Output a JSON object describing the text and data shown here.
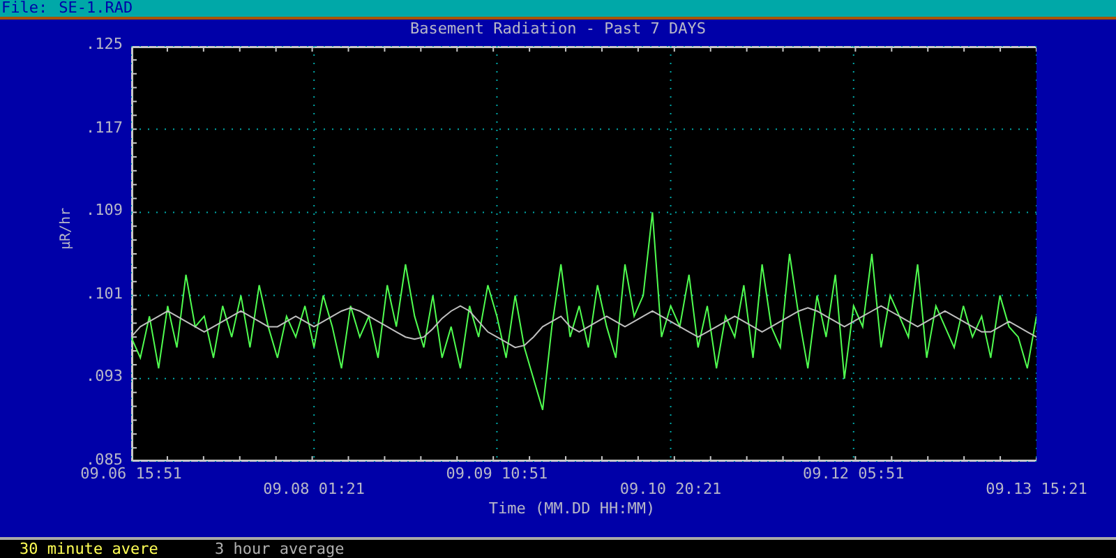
{
  "file_bar": {
    "label": "File:",
    "filename": "SE-1.RAD"
  },
  "chart_data": {
    "type": "line",
    "title": "Basement Radiation - Past 7 DAYS",
    "xlabel": "Time (MM.DD HH:MM)",
    "ylabel": "µR/hr",
    "categories": [
      "09.06 15:51",
      null,
      null,
      null,
      null,
      null,
      null,
      null,
      null,
      null,
      null,
      null,
      null,
      null,
      null,
      null,
      null,
      null,
      null,
      null,
      "09.08 01:21",
      null,
      null,
      null,
      null,
      null,
      null,
      null,
      null,
      null,
      null,
      null,
      null,
      null,
      null,
      null,
      null,
      null,
      null,
      null,
      "09.09 10:51",
      null,
      null,
      null,
      null,
      null,
      null,
      null,
      null,
      null,
      null,
      null,
      null,
      null,
      null,
      null,
      null,
      null,
      null,
      "09.10 20:21",
      null,
      null,
      null,
      null,
      null,
      null,
      null,
      null,
      null,
      null,
      null,
      null,
      null,
      null,
      null,
      null,
      null,
      null,
      null,
      "09.12 05:51",
      null,
      null,
      null,
      null,
      null,
      null,
      null,
      null,
      null,
      null,
      null,
      null,
      null,
      null,
      null,
      null,
      null,
      null,
      null,
      "09.13 15:21"
    ],
    "ylim": [
      0.085,
      0.125
    ],
    "grid": true,
    "yticks": [
      {
        "value": 0.125,
        "label": ".125"
      },
      {
        "value": 0.117,
        "label": ".117"
      },
      {
        "value": 0.109,
        "label": ".109"
      },
      {
        "value": 0.101,
        "label": ".101"
      },
      {
        "value": 0.093,
        "label": ".093"
      },
      {
        "value": 0.085,
        "label": ".085"
      }
    ],
    "series": [
      {
        "name": "30 minute avere",
        "color": "#50ff50",
        "values": [
          0.097,
          0.095,
          0.099,
          0.094,
          0.1,
          0.096,
          0.103,
          0.098,
          0.099,
          0.095,
          0.1,
          0.097,
          0.101,
          0.096,
          0.102,
          0.098,
          0.095,
          0.099,
          0.097,
          0.1,
          0.096,
          0.101,
          0.098,
          0.094,
          0.1,
          0.097,
          0.099,
          0.095,
          0.102,
          0.098,
          0.104,
          0.099,
          0.096,
          0.101,
          0.095,
          0.098,
          0.094,
          0.1,
          0.097,
          0.102,
          0.099,
          0.095,
          0.101,
          0.096,
          0.093,
          0.09,
          0.098,
          0.104,
          0.097,
          0.1,
          0.096,
          0.102,
          0.098,
          0.095,
          0.104,
          0.099,
          0.101,
          0.109,
          0.097,
          0.1,
          0.098,
          0.103,
          0.096,
          0.1,
          0.094,
          0.099,
          0.097,
          0.102,
          0.095,
          0.104,
          0.098,
          0.096,
          0.105,
          0.099,
          0.094,
          0.101,
          0.097,
          0.103,
          0.093,
          0.1,
          0.098,
          0.105,
          0.096,
          0.101,
          0.099,
          0.097,
          0.104,
          0.095,
          0.1,
          0.098,
          0.096,
          0.1,
          0.097,
          0.099,
          0.095,
          0.101,
          0.098,
          0.097,
          0.094,
          0.099
        ]
      },
      {
        "name": "3 hour average",
        "color": "#c0c0c0",
        "values": [
          0.097,
          0.098,
          0.0985,
          0.099,
          0.0995,
          0.099,
          0.0985,
          0.098,
          0.0975,
          0.098,
          0.0985,
          0.099,
          0.0995,
          0.099,
          0.0985,
          0.098,
          0.098,
          0.0985,
          0.099,
          0.0985,
          0.098,
          0.0985,
          0.099,
          0.0995,
          0.0998,
          0.0995,
          0.099,
          0.0985,
          0.098,
          0.0975,
          0.097,
          0.0968,
          0.097,
          0.0978,
          0.0988,
          0.0995,
          0.1,
          0.0995,
          0.0985,
          0.0975,
          0.097,
          0.0965,
          0.096,
          0.0962,
          0.097,
          0.098,
          0.0985,
          0.099,
          0.098,
          0.0975,
          0.098,
          0.0985,
          0.099,
          0.0985,
          0.098,
          0.0985,
          0.099,
          0.0995,
          0.099,
          0.0985,
          0.098,
          0.0975,
          0.097,
          0.0975,
          0.098,
          0.0985,
          0.099,
          0.0985,
          0.098,
          0.0975,
          0.098,
          0.0985,
          0.099,
          0.0995,
          0.0998,
          0.0995,
          0.099,
          0.0985,
          0.098,
          0.0985,
          0.099,
          0.0995,
          0.1,
          0.0995,
          0.099,
          0.0985,
          0.098,
          0.0985,
          0.099,
          0.0995,
          0.099,
          0.0985,
          0.098,
          0.0975,
          0.0975,
          0.098,
          0.0985,
          0.098,
          0.0975,
          0.097
        ]
      }
    ]
  }
}
